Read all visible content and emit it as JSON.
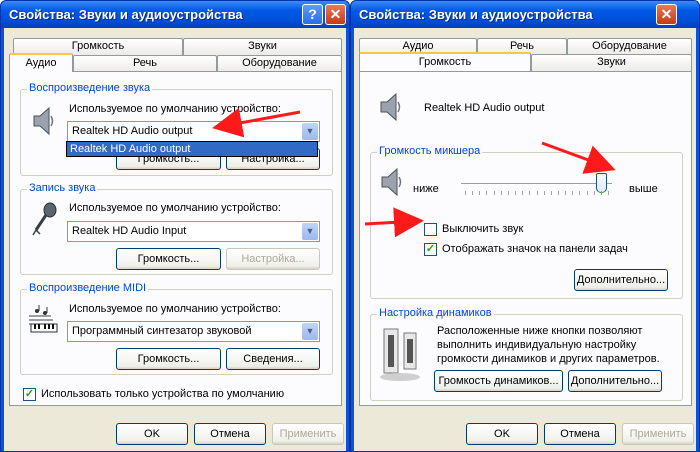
{
  "left": {
    "title": "Свойства: Звуки и аудиоустройства",
    "tabs_back": [
      "Громкость",
      "Звуки"
    ],
    "tabs_front": [
      "Аудио",
      "Речь",
      "Оборудование"
    ],
    "playback": {
      "group_title": "Воспроизведение звука",
      "device_label": "Используемое по умолчанию устройство:",
      "selected": "Realtek HD Audio output",
      "dropdown_option": "Realtek HD Audio output",
      "volume_button": "Громкость...",
      "settings_button": "Настройка..."
    },
    "recording": {
      "group_title": "Запись звука",
      "device_label": "Используемое по умолчанию устройство:",
      "selected": "Realtek HD Audio Input",
      "volume_button": "Громкость...",
      "settings_button": "Настройка..."
    },
    "midi": {
      "group_title": "Воспроизведение MIDI",
      "device_label": "Используемое по умолчанию устройство:",
      "selected": "Программный синтезатор звуковой",
      "volume_button": "Громкость...",
      "about_button": "Сведения..."
    },
    "default_only": "Использовать только устройства по умолчанию",
    "ok": "OK",
    "cancel": "Отмена",
    "apply": "Применить"
  },
  "right": {
    "title": "Свойства: Звуки и аудиоустройства",
    "tabs_back": [
      "Аудио",
      "Речь",
      "Оборудование"
    ],
    "tabs_front": [
      "Громкость",
      "Звуки"
    ],
    "device_name": "Realtek HD Audio output",
    "mixer": {
      "group_title": "Громкость микшера",
      "low": "ниже",
      "high": "выше",
      "level": 0.95,
      "mute": "Выключить звук",
      "show_icon": "Отображать значок на панели задач",
      "advanced_button": "Дополнительно..."
    },
    "speakers": {
      "group_title": "Настройка динамиков",
      "description": [
        "Расположенные ниже кнопки позволяют",
        "выполнить индивидуальную настройку",
        "громкости динамиков и других параметров."
      ],
      "volume_button": "Громкость динамиков...",
      "advanced_button": "Дополнительно..."
    },
    "ok": "OK",
    "cancel": "Отмена",
    "apply": "Применить"
  },
  "colors": {
    "accent": "#ff1a1a",
    "title_blue": "#0050d8",
    "group_title": "#0046d5"
  },
  "icons": [
    "help-icon",
    "close-icon",
    "speaker-icon",
    "microphone-icon",
    "midi-keyboard-icon",
    "speakers-icon",
    "chevron-down-icon"
  ]
}
